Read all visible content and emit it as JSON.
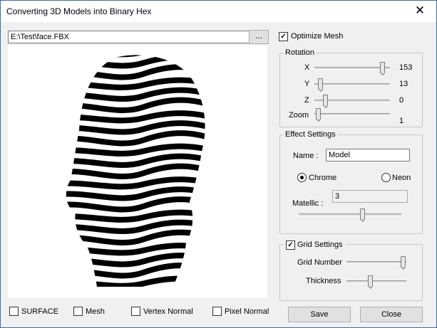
{
  "window": {
    "title": "Converting 3D Models into Binary Hex",
    "close_glyph": "✕"
  },
  "file": {
    "path": "E:\\Test\\face.FBX",
    "browse_label": "..."
  },
  "preview": {
    "content": "striped 3D head model render"
  },
  "optimize_mesh": {
    "label": "Optimize Mesh",
    "checked": true
  },
  "rotation": {
    "title": "Rotation",
    "x": {
      "label": "X",
      "value": "153"
    },
    "y": {
      "label": "Y",
      "value": "13"
    },
    "z": {
      "label": "Z",
      "value": "0"
    },
    "zoom": {
      "label": "Zoom",
      "value": "1"
    }
  },
  "effect": {
    "title": "Effect Settings",
    "name_label": "Name :",
    "name_value": "Model",
    "chrome_label": "Chrome",
    "neon_label": "Neon",
    "selected": "Chrome",
    "metallic_label": "Matellic :",
    "metallic_value": "3"
  },
  "grid": {
    "title": "Grid Settings",
    "checked": true,
    "number_label": "Grid Number",
    "thickness_label": "Thickness"
  },
  "render_options": {
    "surface": "SURFACE",
    "mesh": "Mesh",
    "vertex_normal": "Vertex Normal",
    "pixel_normal": "Pixel Normal"
  },
  "buttons": {
    "save": "Save",
    "close": "Close"
  },
  "slider_levels": {
    "rotation_x": 0.92,
    "rotation_y": 0.05,
    "rotation_z": 0.12,
    "zoom": 0.02,
    "metallic": 0.62,
    "grid_number": 0.98,
    "thickness": 0.38
  }
}
